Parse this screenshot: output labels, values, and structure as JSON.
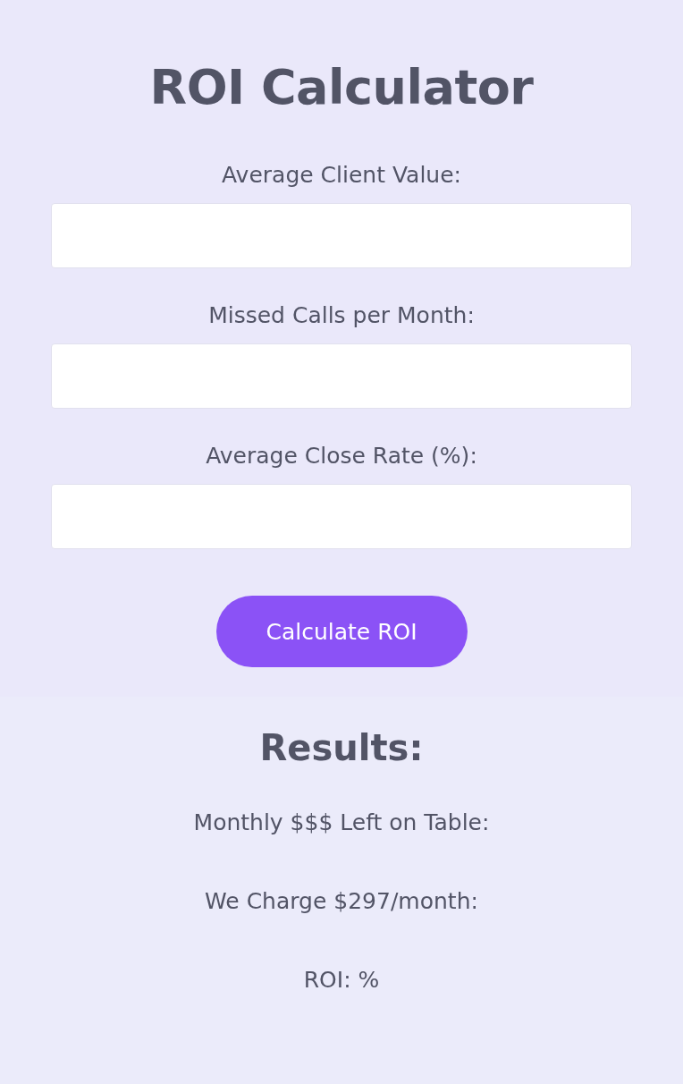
{
  "title": "ROI Calculator",
  "fields": [
    {
      "label": "Average Client Value:"
    },
    {
      "label": "Missed Calls per Month:"
    },
    {
      "label": "Average Close Rate (%):"
    }
  ],
  "button": {
    "label": "Calculate ROI"
  },
  "results": {
    "heading": "Results:",
    "lines": [
      "Monthly $$$ Left on Table:",
      "We Charge $297/month:",
      "ROI: %"
    ]
  }
}
